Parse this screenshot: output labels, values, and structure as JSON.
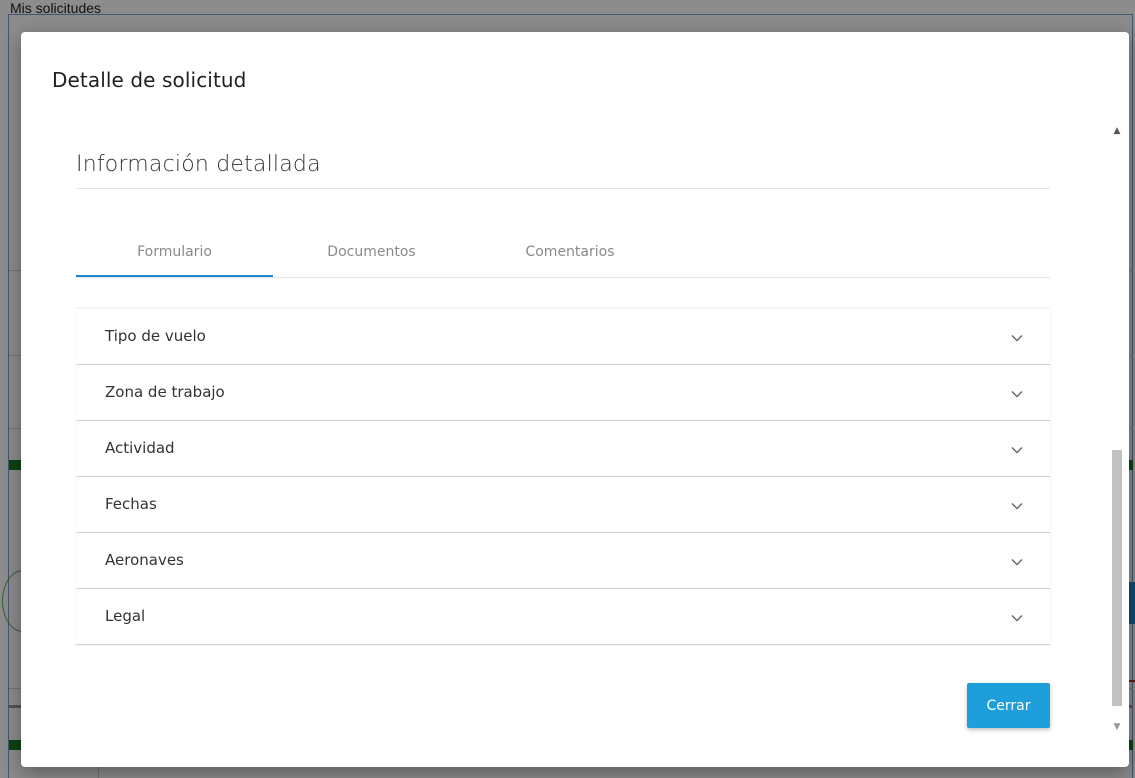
{
  "background": {
    "page_title": "Mis solicitudes"
  },
  "modal": {
    "title": "Detalle de solicitud",
    "section_title": "Información detallada",
    "tabs": [
      {
        "label": "Formulario",
        "active": true
      },
      {
        "label": "Documentos",
        "active": false
      },
      {
        "label": "Comentarios",
        "active": false
      }
    ],
    "accordion": [
      {
        "label": "Tipo de vuelo",
        "icon": "chevron-down-icon"
      },
      {
        "label": "Zona de trabajo",
        "icon": "chevron-down-icon"
      },
      {
        "label": "Actividad",
        "icon": "chevron-down-icon"
      },
      {
        "label": "Fechas",
        "icon": "chevron-down-icon"
      },
      {
        "label": "Aeronaves",
        "icon": "chevron-down-icon"
      },
      {
        "label": "Legal",
        "icon": "chevron-down-icon"
      }
    ],
    "close_label": "Cerrar"
  },
  "colors": {
    "accent": "#1e88d2",
    "button": "#1e9fdb",
    "overlay": "rgba(0,0,0,0.45)"
  }
}
